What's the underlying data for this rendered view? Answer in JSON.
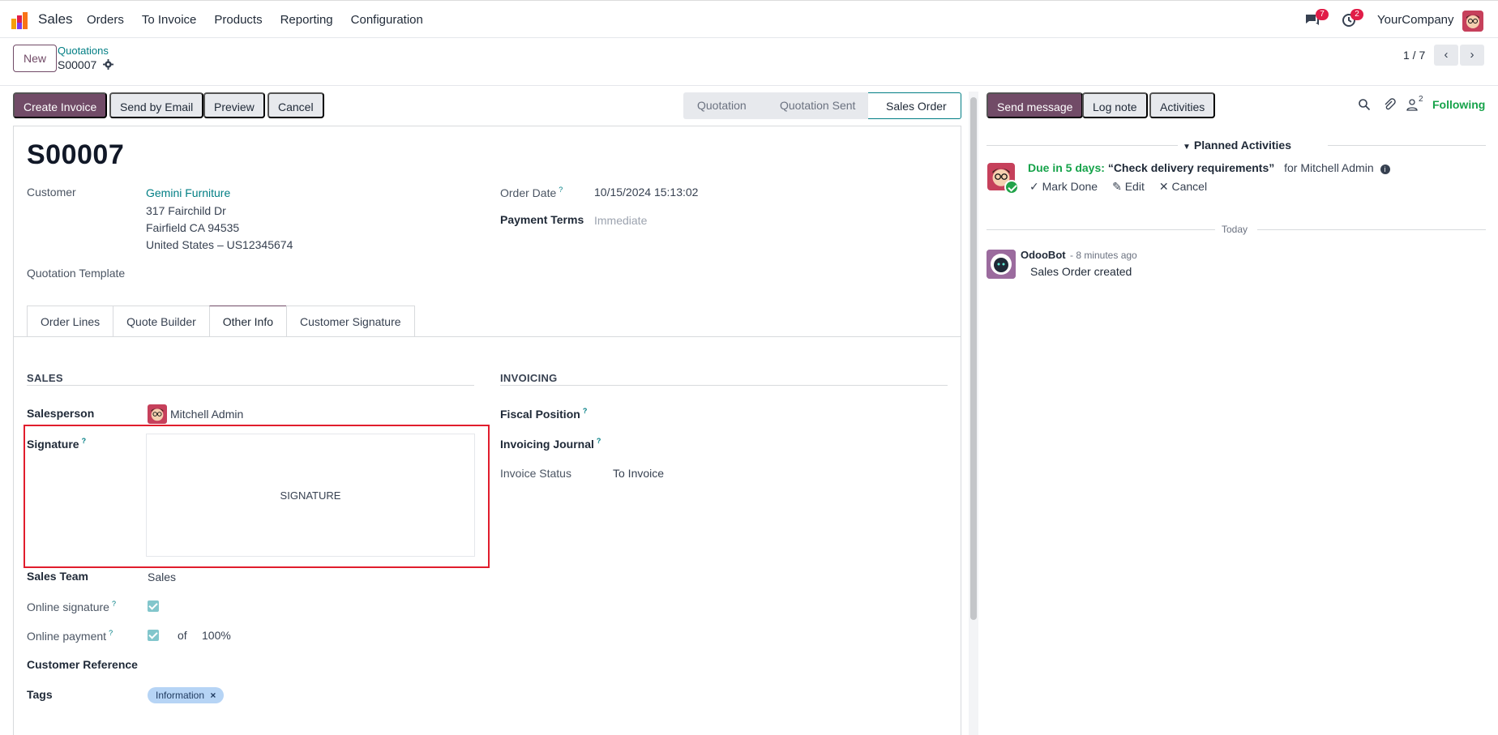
{
  "nav": {
    "app_name": "Sales",
    "menu": [
      "Orders",
      "To Invoice",
      "Products",
      "Reporting",
      "Configuration"
    ],
    "chat_count": "7",
    "activity_count": "2",
    "company": "YourCompany"
  },
  "control": {
    "new_label": "New",
    "breadcrumb_parent": "Quotations",
    "breadcrumb_current": "S00007",
    "pager": "1 / 7"
  },
  "actions": {
    "create_invoice": "Create Invoice",
    "send_email": "Send by Email",
    "preview": "Preview",
    "cancel": "Cancel"
  },
  "statusbar": {
    "stages": [
      "Quotation",
      "Quotation Sent",
      "Sales Order"
    ],
    "current": "Sales Order"
  },
  "form": {
    "title": "S00007",
    "customer_label": "Customer",
    "customer_name": "Gemini Furniture",
    "address_line1": "317 Fairchild Dr",
    "address_line2": "Fairfield CA 94535",
    "address_line3": "United States – US12345674",
    "quotation_template_label": "Quotation Template",
    "order_date_label": "Order Date",
    "order_date": "10/15/2024 15:13:02",
    "payment_terms_label": "Payment Terms",
    "payment_terms_placeholder": "Immediate"
  },
  "tabs": [
    "Order Lines",
    "Quote Builder",
    "Other Info",
    "Customer Signature"
  ],
  "active_tab": "Other Info",
  "other_info": {
    "sales_section": "SALES",
    "salesperson_label": "Salesperson",
    "salesperson": "Mitchell Admin",
    "signature_label": "Signature",
    "signature_placeholder": "SIGNATURE",
    "sales_team_label": "Sales Team",
    "sales_team": "Sales",
    "online_signature_label": "Online signature",
    "online_signature_checked": true,
    "online_payment_label": "Online payment",
    "online_payment_checked": true,
    "of_label": "of",
    "payment_percent": "100%",
    "customer_reference_label": "Customer Reference",
    "tags_label": "Tags",
    "tags": [
      "Information"
    ],
    "invoicing_section": "INVOICING",
    "fiscal_position_label": "Fiscal Position",
    "invoicing_journal_label": "Invoicing Journal",
    "invoice_status_label": "Invoice Status",
    "invoice_status": "To Invoice"
  },
  "chatter": {
    "send_message": "Send message",
    "log_note": "Log note",
    "activities": "Activities",
    "followers_count": "2",
    "following": "Following",
    "planned_activities": "Planned Activities",
    "activity": {
      "due": "Due in 5 days:",
      "summary": "“Check delivery requirements”",
      "assignee": "for Mitchell Admin",
      "mark_done": "Mark Done",
      "edit": "Edit",
      "cancel": "Cancel"
    },
    "date_separator": "Today",
    "message": {
      "author": "OdooBot",
      "time": "- 8 minutes ago",
      "body": "Sales Order created"
    }
  },
  "colors": {
    "brand": "#714b67",
    "link": "#017e84",
    "highlight": "#e11d2d",
    "success": "#16a34a"
  }
}
